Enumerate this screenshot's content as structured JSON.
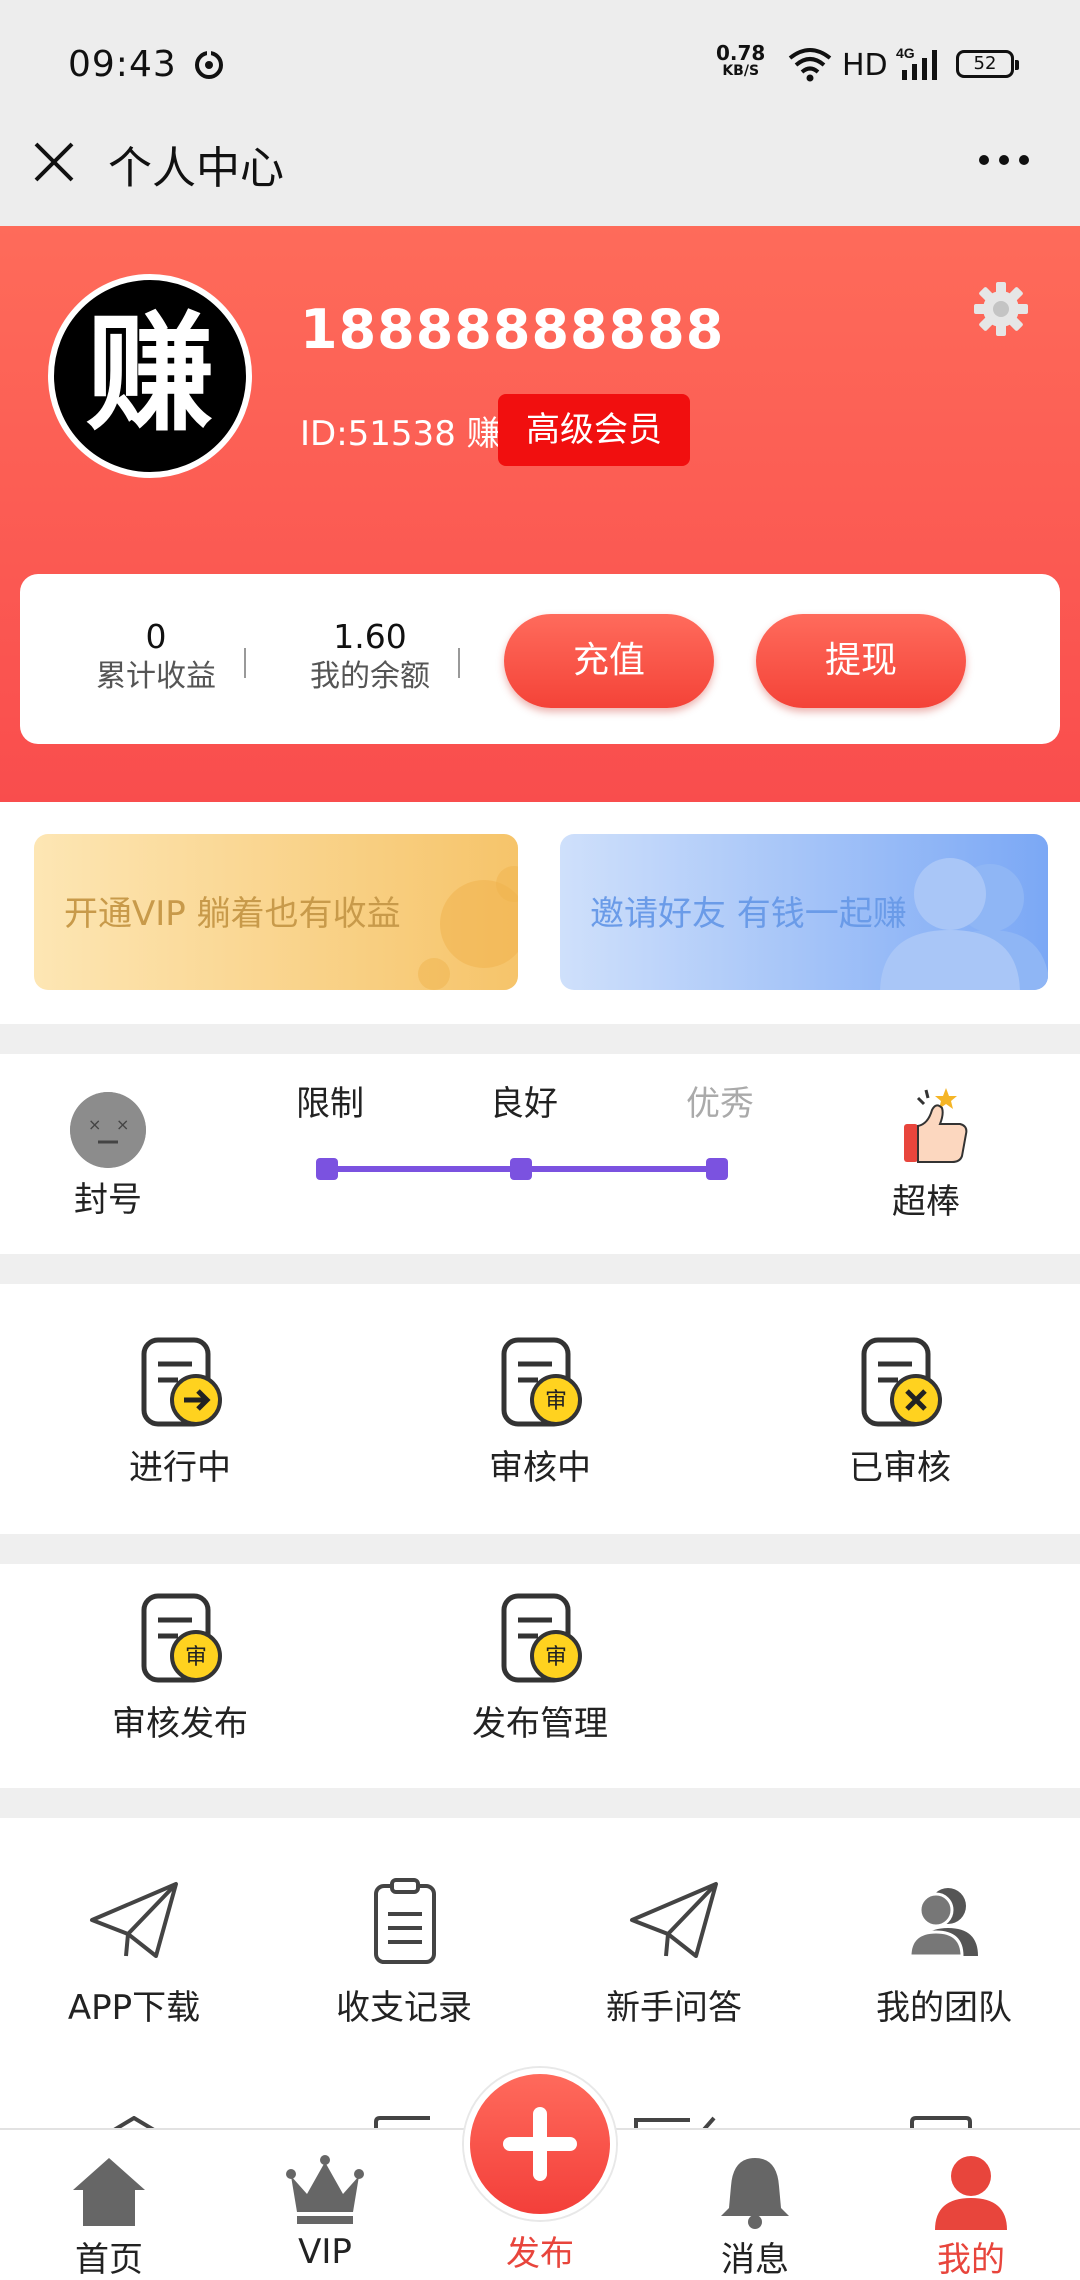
{
  "status_bar": {
    "time": "09:43",
    "net_speed_value": "0.78",
    "net_speed_unit": "KB/S",
    "hd": "HD",
    "signal": "4G",
    "battery": "52"
  },
  "title_bar": {
    "title": "个人中心"
  },
  "profile": {
    "avatar_char": "赚",
    "username": "18888888888",
    "id_text": "ID:51538 赚",
    "member_badge": "高级会员"
  },
  "stats": {
    "total_income_value": "0",
    "total_income_label": "累计收益",
    "balance_value": "1.60",
    "balance_label": "我的余额",
    "recharge_label": "充值",
    "withdraw_label": "提现"
  },
  "promos": {
    "vip": "开通VIP 躺着也有收益",
    "invite": "邀请好友 有钱一起赚"
  },
  "credit_level": {
    "left_label": "封号",
    "levels": [
      "限制",
      "良好",
      "优秀"
    ],
    "right_label": "超棒",
    "line_color": "#7b52e0"
  },
  "tasks": {
    "row1": [
      "进行中",
      "审核中",
      "已审核"
    ],
    "row2": [
      "审核发布",
      "发布管理"
    ],
    "badge_char": "审"
  },
  "menu": {
    "items": [
      "APP下载",
      "收支记录",
      "新手问答",
      "我的团队"
    ]
  },
  "bottom_nav": {
    "home": "首页",
    "vip": "VIP",
    "publish": "发布",
    "messages": "消息",
    "mine": "我的",
    "active_color": "#e8453c"
  }
}
